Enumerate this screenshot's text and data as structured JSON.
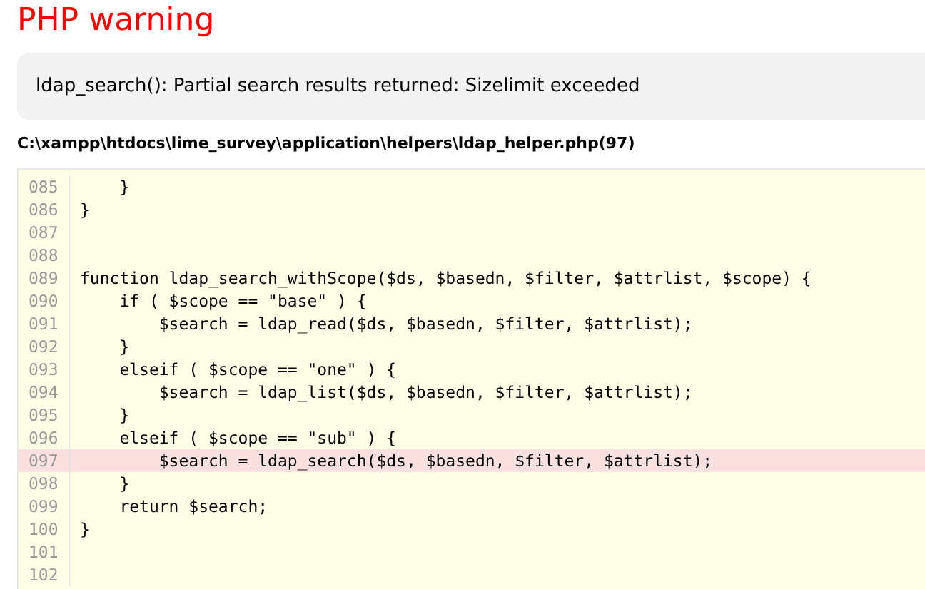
{
  "title": "PHP warning",
  "message": "ldap_search(): Partial search results returned: Sizelimit exceeded",
  "file_path": "C:\\xampp\\htdocs\\lime_survey\\application\\helpers\\ldap_helper.php(97)",
  "code_lines": [
    {
      "number": "085",
      "code": "    }",
      "highlighted": false
    },
    {
      "number": "086",
      "code": "}",
      "highlighted": false
    },
    {
      "number": "087",
      "highlighted": false
    },
    {
      "number": "088",
      "highlighted": false
    },
    {
      "number": "089",
      "code": "function ldap_search_withScope($ds, $basedn, $filter, $attrlist, $scope) {",
      "highlighted": false
    },
    {
      "number": "090",
      "code": "    if ( $scope == \"base\" ) {",
      "highlighted": false
    },
    {
      "number": "091",
      "code": "        $search = ldap_read($ds, $basedn, $filter, $attrlist);",
      "highlighted": false
    },
    {
      "number": "092",
      "code": "    }",
      "highlighted": false
    },
    {
      "number": "093",
      "code": "    elseif ( $scope == \"one\" ) {",
      "highlighted": false
    },
    {
      "number": "094",
      "code": "        $search = ldap_list($ds, $basedn, $filter, $attrlist);",
      "highlighted": false
    },
    {
      "number": "095",
      "code": "    }",
      "highlighted": false
    },
    {
      "number": "096",
      "code": "    elseif ( $scope == \"sub\" ) {",
      "highlighted": false
    },
    {
      "number": "097",
      "code": "        $search = ldap_search($ds, $basedn, $filter, $attrlist);",
      "highlighted": true
    },
    {
      "number": "098",
      "code": "    }",
      "highlighted": false
    },
    {
      "number": "099",
      "code": "    return $search;",
      "highlighted": false
    },
    {
      "number": "100",
      "code": "}",
      "highlighted": false
    },
    {
      "number": "101",
      "highlighted": false
    },
    {
      "number": "102",
      "highlighted": false
    }
  ]
}
